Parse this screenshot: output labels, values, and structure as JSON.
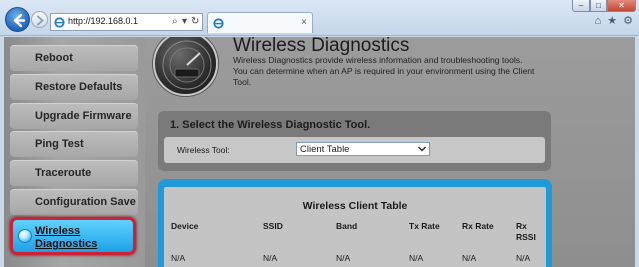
{
  "browser": {
    "address": "http://192.168.0.1",
    "address_icons": [
      "search-icon",
      "refresh-icon"
    ],
    "tab_close": "×",
    "window_controls": {
      "minimize": "–",
      "maximize": "□",
      "close": "✕"
    },
    "toolbar_icons": {
      "home": "⌂",
      "favorites": "★",
      "tools": "⚙"
    }
  },
  "sidebar": {
    "items": [
      {
        "label": "Reboot"
      },
      {
        "label": "Restore Defaults"
      },
      {
        "label": "Upgrade Firmware"
      },
      {
        "label": "Ping Test"
      },
      {
        "label": "Traceroute"
      },
      {
        "label": "Configuration Save"
      },
      {
        "label": "Wireless Diagnostics",
        "line1": "Wireless",
        "line2": "Diagnostics",
        "active": true
      }
    ]
  },
  "main": {
    "title": "Wireless Diagnostics",
    "description": "Wireless Diagnostics provide wireless information and troubleshooting tools. You can determine when an AP is required in your environment using the Client Tool.",
    "select_section": {
      "heading": "1. Select the Wireless Diagnostic Tool.",
      "label": "Wireless Tool:",
      "selected": "Client Table"
    },
    "table": {
      "title": "Wireless Client Table",
      "columns": [
        {
          "line1": "Device",
          "line2": ""
        },
        {
          "line1": "SSID",
          "line2": ""
        },
        {
          "line1": "Band",
          "line2": ""
        },
        {
          "line1": "Tx Rate",
          "line2": ""
        },
        {
          "line1": "Rx Rate",
          "line2": ""
        },
        {
          "line1": "Rx",
          "line2": "RSSI"
        }
      ],
      "rows": [
        [
          "N/A",
          "N/A",
          "N/A",
          "N/A",
          "N/A",
          "N/A"
        ]
      ]
    }
  },
  "colors": {
    "accent": "#1d9ad7",
    "active_outline": "#cc2233",
    "active_fill": "#3bbdf3"
  }
}
